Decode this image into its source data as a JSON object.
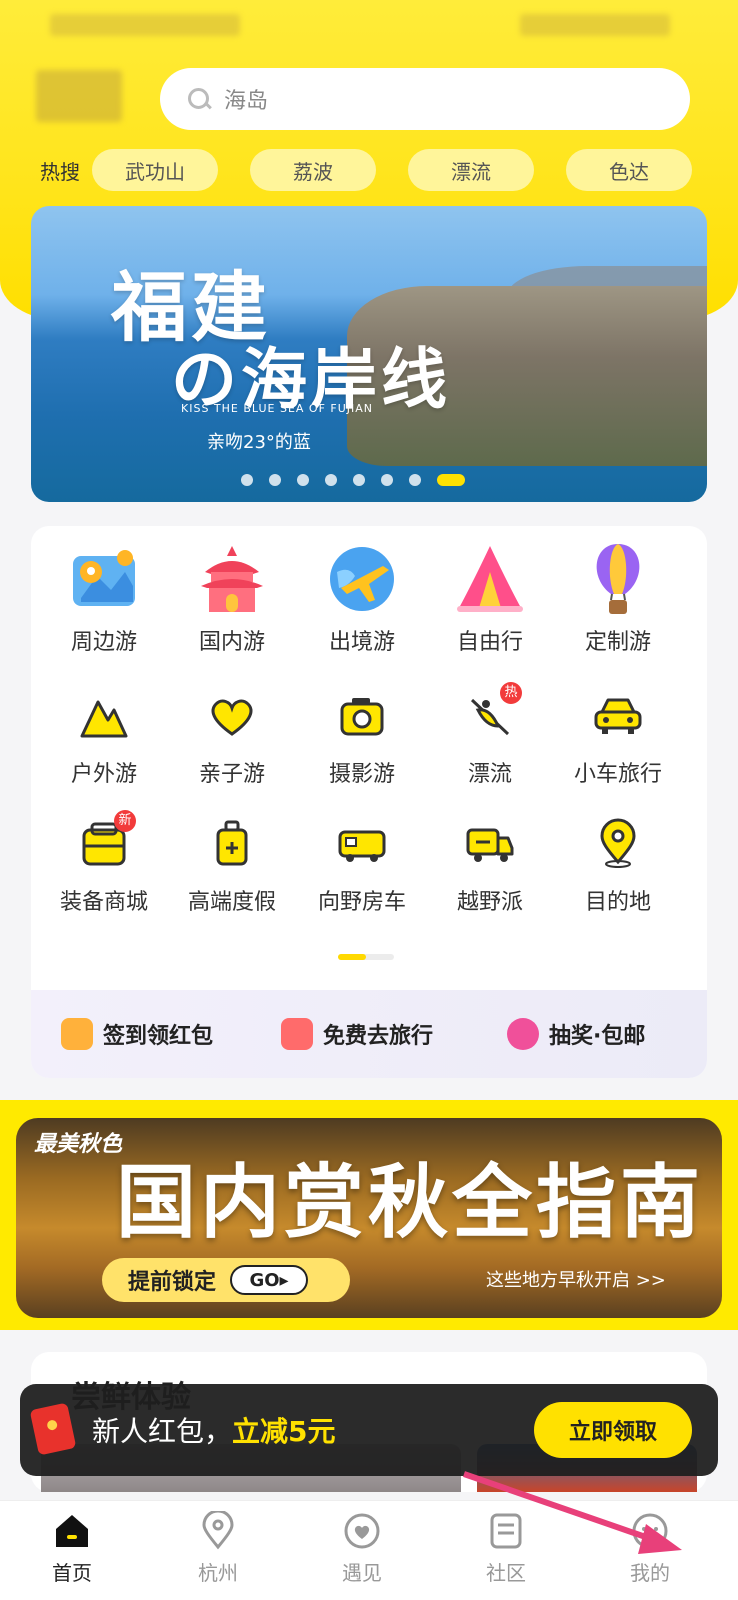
{
  "search": {
    "placeholder": "海岛"
  },
  "hot_search": {
    "label": "热搜",
    "items": [
      "武功山",
      "荔波",
      "漂流",
      "色达"
    ]
  },
  "banner": {
    "title_line1": "福建",
    "title_line2": "の海岸线",
    "subtitle_en": "KISS THE BLUE SEA OF FUJIAN",
    "subtitle_cn": "亲吻23°的蓝",
    "page_count": 8,
    "active_page": 8
  },
  "categories": {
    "primary": [
      {
        "label": "周边游",
        "icon": "map-pin-icon"
      },
      {
        "label": "国内游",
        "icon": "temple-icon"
      },
      {
        "label": "出境游",
        "icon": "globe-plane-icon"
      },
      {
        "label": "自由行",
        "icon": "tent-icon"
      },
      {
        "label": "定制游",
        "icon": "hot-air-balloon-icon"
      }
    ],
    "secondary": [
      {
        "label": "户外游",
        "icon": "mountain-icon"
      },
      {
        "label": "亲子游",
        "icon": "heart-icon"
      },
      {
        "label": "摄影游",
        "icon": "camera-icon"
      },
      {
        "label": "漂流",
        "icon": "kayak-icon",
        "badge": "热"
      },
      {
        "label": "小车旅行",
        "icon": "car-icon"
      },
      {
        "label": "装备商城",
        "icon": "backpack-icon",
        "badge": "新"
      },
      {
        "label": "高端度假",
        "icon": "luggage-icon"
      },
      {
        "label": "向野房车",
        "icon": "camper-icon"
      },
      {
        "label": "越野派",
        "icon": "truck-icon"
      },
      {
        "label": "目的地",
        "icon": "location-icon"
      }
    ]
  },
  "promos": [
    {
      "label": "签到领红包",
      "icon": "calendar-check-icon"
    },
    {
      "label": "免费去旅行",
      "icon": "gift-box-icon"
    },
    {
      "label": "抽奖·包邮",
      "icon": "prize-wheel-icon"
    }
  ],
  "autumn_banner": {
    "tag": "最美秋色",
    "title": "国内赏秋全指南",
    "cta": "提前锁定",
    "go": "GO▸",
    "side_text": "这些地方早秋开启 >>"
  },
  "section": {
    "title": "尝鲜体验"
  },
  "toast": {
    "text_prefix": "新人红包，",
    "text_highlight": "立减5元",
    "button": "立即领取"
  },
  "tabbar": [
    {
      "label": "首页",
      "icon": "home-icon",
      "active": true
    },
    {
      "label": "杭州",
      "icon": "location-icon",
      "active": false
    },
    {
      "label": "遇见",
      "icon": "heart-circle-icon",
      "active": false
    },
    {
      "label": "社区",
      "icon": "community-icon",
      "active": false
    },
    {
      "label": "我的",
      "icon": "profile-icon",
      "active": false
    }
  ],
  "colors": {
    "brand_yellow": "#ffe100",
    "annotation_arrow": "#e8407a"
  }
}
